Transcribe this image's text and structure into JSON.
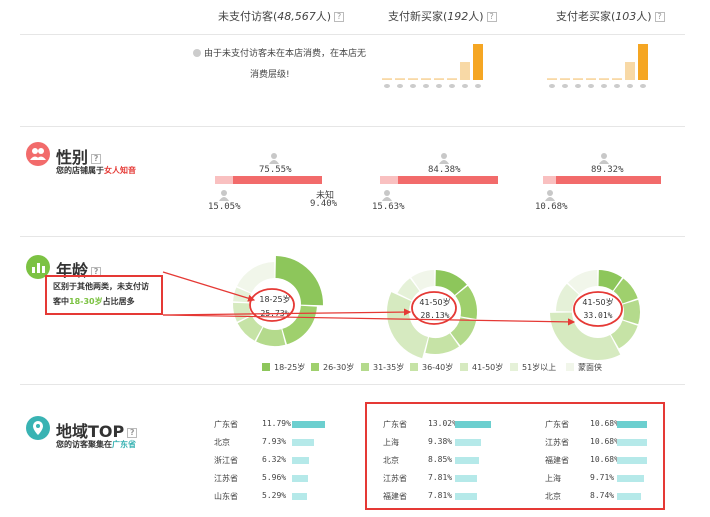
{
  "header": {
    "columns": [
      {
        "label": "未支付访客",
        "count": "48,567",
        "unit": "人"
      },
      {
        "label": "支付新买家",
        "count": "192",
        "unit": "人"
      },
      {
        "label": "支付老买家",
        "count": "103",
        "unit": "人"
      }
    ],
    "note_line1": "由于未支付访客未在本店消费，在本店无",
    "note_line2": "消费层级!"
  },
  "spend_bars": {
    "new_buyers": [
      0.05,
      0.05,
      0.05,
      0.05,
      0.05,
      0.05,
      0.5,
      1.0
    ],
    "old_buyers": [
      0.05,
      0.05,
      0.05,
      0.05,
      0.05,
      0.05,
      0.5,
      1.0
    ],
    "colors": [
      "#f8d9a6",
      "#f5a623"
    ]
  },
  "gender": {
    "title": "性别",
    "subtitle_prefix": "您的店铺属于",
    "subtitle_highlight": "女人知音",
    "groups": [
      {
        "female_pct": "75.55%",
        "male_pct": "15.05%",
        "unknown_label": "未知",
        "unknown_pct": "9.40%",
        "female": 75.55,
        "male": 15.05
      },
      {
        "female_pct": "84.38%",
        "male_pct": "15.63%",
        "female": 84.38,
        "male": 15.63
      },
      {
        "female_pct": "89.32%",
        "male_pct": "10.68%",
        "female": 89.32,
        "male": 10.68
      }
    ],
    "colors": {
      "female": "#f26b6b",
      "male": "#f9c0c0",
      "icon": "#c8c8c8"
    }
  },
  "age": {
    "title": "年龄",
    "annotation": {
      "line1": "区别于其他两类，未支付访",
      "line2_prefix": "客中",
      "line2_highlight": "18-30岁",
      "line2_suffix": "占比居多"
    },
    "donuts": [
      {
        "label": "18-25岁",
        "pct": "25.73%",
        "values": [
          25.73,
          20,
          12,
          10,
          8,
          6,
          18.27
        ]
      },
      {
        "label": "41-50岁",
        "pct": "28.13%",
        "values": [
          14,
          14,
          12,
          14,
          28.13,
          8,
          9.87
        ]
      },
      {
        "label": "41-50岁",
        "pct": "33.01%",
        "values": [
          10,
          10,
          10,
          12,
          33.01,
          12,
          12.99
        ]
      }
    ],
    "legend": [
      {
        "label": "18-25岁",
        "color": "#8dc65b"
      },
      {
        "label": "26-30岁",
        "color": "#9fd06d"
      },
      {
        "label": "31-35岁",
        "color": "#b4da8c"
      },
      {
        "label": "36-40岁",
        "color": "#c6e3a6"
      },
      {
        "label": "41-50岁",
        "color": "#d6eac0"
      },
      {
        "label": "51岁以上",
        "color": "#e5f1d8"
      },
      {
        "label": "蒙面侠",
        "color": "#f1f6ea"
      }
    ]
  },
  "region": {
    "title": "地域TOP",
    "subtitle_prefix": "您的访客聚集在",
    "subtitle_highlight": "广东省",
    "columns": [
      [
        {
          "name": "广东省",
          "pct": "11.79%",
          "v": 11.79
        },
        {
          "name": "北京",
          "pct": "7.93%",
          "v": 7.93
        },
        {
          "name": "浙江省",
          "pct": "6.32%",
          "v": 6.32
        },
        {
          "name": "江苏省",
          "pct": "5.96%",
          "v": 5.96
        },
        {
          "name": "山东省",
          "pct": "5.29%",
          "v": 5.29
        }
      ],
      [
        {
          "name": "广东省",
          "pct": "13.02%",
          "v": 13.02
        },
        {
          "name": "上海",
          "pct": "9.38%",
          "v": 9.38
        },
        {
          "name": "北京",
          "pct": "8.85%",
          "v": 8.85
        },
        {
          "name": "江苏省",
          "pct": "7.81%",
          "v": 7.81
        },
        {
          "name": "福建省",
          "pct": "7.81%",
          "v": 7.81
        }
      ],
      [
        {
          "name": "广东省",
          "pct": "10.68%",
          "v": 10.68
        },
        {
          "name": "江苏省",
          "pct": "10.68%",
          "v": 10.68
        },
        {
          "name": "福建省",
          "pct": "10.68%",
          "v": 10.68
        },
        {
          "name": "上海",
          "pct": "9.71%",
          "v": 9.71
        },
        {
          "name": "北京",
          "pct": "8.74%",
          "v": 8.74
        }
      ]
    ],
    "colors": {
      "top": "#6ccfcf",
      "rest": "#b5e9e9"
    }
  },
  "colors": {
    "accent_green": "#7cc243",
    "accent_teal": "#39b3b3",
    "annotation_red": "#e53935",
    "highlight_red": "#e53935"
  }
}
